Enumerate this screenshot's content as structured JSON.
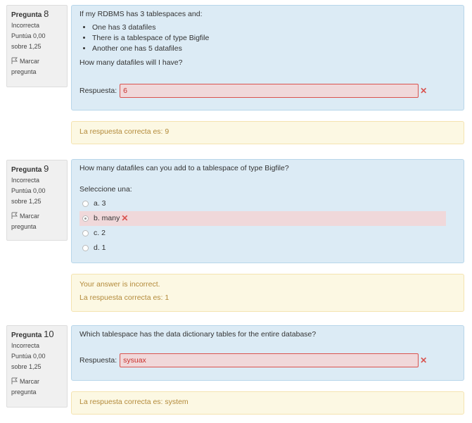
{
  "questions": [
    {
      "number": "8",
      "prefix": "Pregunta",
      "status": "Incorrecta",
      "score": "Puntúa 0,00 sobre 1,25",
      "flag": "Marcar pregunta",
      "text": "If my RDBMS has 3 tablespaces and:",
      "items": [
        "One has 3 datafiles",
        "There is a tablespace of type Bigfile",
        "Another one has 5 datafiles"
      ],
      "prompt": "How many datafiles will I have?",
      "answer_label": "Respuesta:",
      "answer_value": "6",
      "feedback_incorrect": "",
      "feedback": "La respuesta correcta es: 9"
    },
    {
      "number": "9",
      "prefix": "Pregunta",
      "status": "Incorrecta",
      "score": "Puntúa 0,00 sobre 1,25",
      "flag": "Marcar pregunta",
      "text": "How many datafiles can you add to a tablespace of type Bigfile?",
      "select_label": "Seleccione una:",
      "options": [
        "a. 3",
        "b. many",
        "c. 2",
        "d. 1"
      ],
      "selected": "b. many",
      "feedback_incorrect": "Your answer is incorrect.",
      "feedback": "La respuesta correcta es: 1"
    },
    {
      "number": "10",
      "prefix": "Pregunta",
      "status": "Incorrecta",
      "score": "Puntúa 0,00 sobre 1,25",
      "flag": "Marcar pregunta",
      "text": "Which tablespace has the data dictionary tables for the entire database?",
      "answer_label": "Respuesta:",
      "answer_value": "sysuax",
      "feedback": "La respuesta correcta es: system"
    }
  ],
  "icons": {
    "flag": "flag-icon",
    "incorrect": "cross-icon"
  },
  "colors": {
    "question_bg": "#dcebf5",
    "feedback_bg": "#fcf8e3",
    "incorrect": "#d9534f"
  }
}
